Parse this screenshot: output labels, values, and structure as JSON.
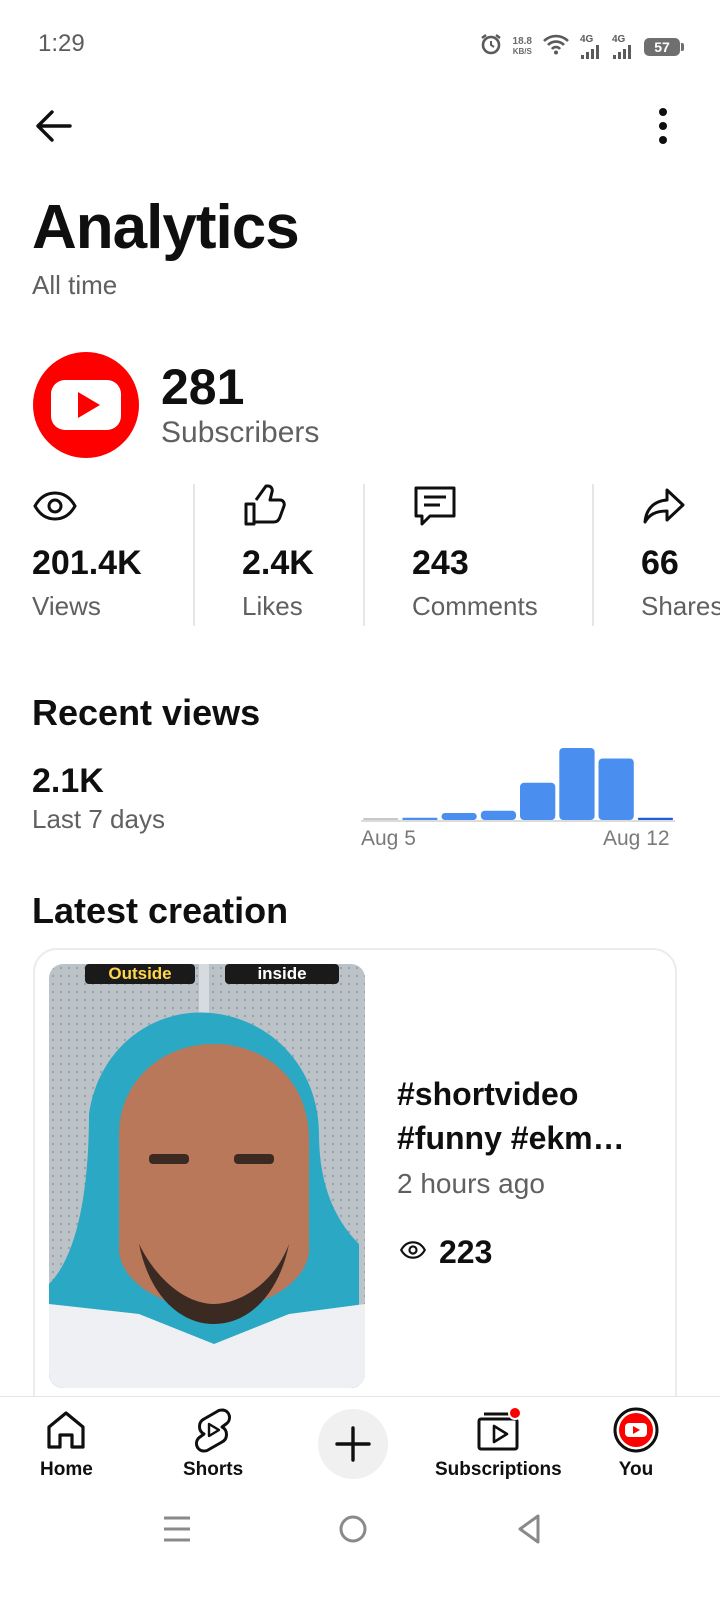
{
  "status_bar": {
    "time": "1:29",
    "net_speed_value": "18.8",
    "net_speed_unit": "KB/S",
    "network_1": "4G",
    "network_2": "4G",
    "battery": "57"
  },
  "header": {
    "title": "Analytics",
    "subtitle": "All time"
  },
  "channel": {
    "subscribers": "281",
    "subscribers_label": "Subscribers"
  },
  "stats": [
    {
      "icon": "eye-icon",
      "value": "201.4K",
      "label": "Views"
    },
    {
      "icon": "thumbs-up-icon",
      "value": "2.4K",
      "label": "Likes"
    },
    {
      "icon": "comment-icon",
      "value": "243",
      "label": "Comments"
    },
    {
      "icon": "share-icon",
      "value": "66",
      "label": "Shares"
    }
  ],
  "recent_views": {
    "title": "Recent views",
    "count": "2.1K",
    "period": "Last 7 days",
    "start_label": "Aug 5",
    "end_label": "Aug 12"
  },
  "chart_data": {
    "type": "bar",
    "categories": [
      "Aug 5",
      "",
      "",
      "",
      "",
      "",
      "",
      "Aug 12"
    ],
    "values": [
      1,
      2,
      6,
      8,
      32,
      62,
      53,
      2
    ],
    "bar_colors": [
      "#c8c8c8",
      "#4a8ff0",
      "#4a8ff0",
      "#4a8ff0",
      "#4a8ff0",
      "#4a8ff0",
      "#4a8ff0",
      "#1f5ed8"
    ],
    "ylim": [
      0,
      62
    ]
  },
  "latest_creation": {
    "title": "Latest creation",
    "video_title": "#shortvideo #funny #ekm…",
    "time": "2 hours ago",
    "views": "223",
    "thumb_text_outside": "Outside",
    "thumb_text_inside": "inside"
  },
  "nav": {
    "home": "Home",
    "shorts": "Shorts",
    "subscriptions": "Subscriptions",
    "you": "You"
  },
  "colors": {
    "accent": "#ff0000",
    "bar": "#4a8ff0",
    "muted_text": "#606060"
  }
}
